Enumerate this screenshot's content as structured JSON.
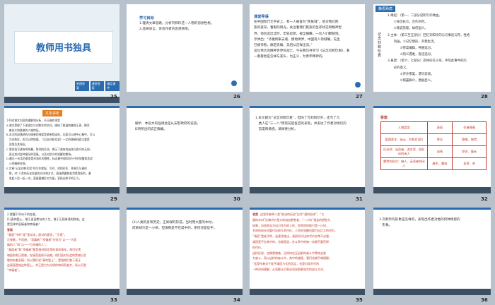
{
  "s25": {
    "title": "教师用书独具",
    "tags": [
      "补偿答案",
      "课堂答案",
      "精品课件"
    ],
    "num": "25"
  },
  "s26": {
    "hdr": "学习目标",
    "lines": [
      "1.理清文章思路，分析刘和珍这一人物的思想性格。",
      "2.品味语言，体会作者的思想感情。"
    ],
    "num": "26"
  },
  "s27": {
    "hdr": "课堂导语",
    "lines": [
      "在中国现代文学史上，有一人被誉为“民族魂”。他对我们民",
      "族的爱深，着眼的目光，关注着我们民族的生存状态和精神世",
      "界。他创造出北时，年轻思想，被全播撒，一位人们都铭刻，",
      "示弹出：“浓着倒来去看，摸地哄界，中国有人领城曦，先生",
      "已被作者，痛定思痛，又绍从这样出流。”",
      "这位伟大的精神世界的战士，今天我们共学习《记念刘和珍君》，看",
      "一看看他是怎样与某头、为正义，为青年精神的。"
    ],
    "num": "27"
  },
  "s28": {
    "hdr": "静思熟虑",
    "side": "记念刘和珍君",
    "lines": [
      "1.缘起：（第一、二部分说明写作缘由。",
      "　　①悼念执写，合作的时。",
      "　　②喻说凯理，如何国人。",
      "2.主体：（第三至五部分）回忆刘和珍的与号事迹与死，性格",
      "　　刻画。①记忆情形，刘我生活。",
      "　　　　②惨案编辑，神遍选讨。",
      "　　　　③刻义遇难，客迹选讨。",
      "3.悬望：（第六、七部分）悲悼的已义形，评简此事件的历",
      "　　史的意义。",
      "　　　　①评论惨案，遗尽悲悯。",
      "　　　　②揭露群众，激励后人。"
    ],
    "num": "28"
  },
  "s29": {
    "hdr": "文本讲析",
    "lines": [
      "下列对课文内容的理解和分析，不正确的项是",
      "A.课文是按了下述追忆与刘和珍的交往，描绘了她温和善良正直、微笑",
      "　着抗大和勇敢的人格特征。",
      "B.本文的段落结构与情感的线索是紧密相连的，后面可以使中心集中，可以",
      "　为刘和珍，也可以惨恤案。《记念刘和珍君》一文的情感线索主要是",
      "　悲愤及其悼念。",
      "C.第四段写政府的残暴，陈列的反讽，揭示了政府的凶残与群众的无知，",
      "　表达其对此种情况的悲痛，以及对民众的觉醒的期待。",
      "D.最后一句话的意思是刘和珍的牺牲，标志着中国知识分子的觉醒和其战",
      "　斗的精神发扬。",
      "E.文章“记念刘和珍君”的写作缘起、写刘、刘和珍死、并借写与事的",
      "　愤，对“人类的历史发展的方向和方式，直接揭露和批判是我所的，激",
      "　发起人民一起一次，直接震撼反对力量，宣扬出和平的正义。"
    ],
    "num": "29"
  },
  "s30": {
    "hdr": "",
    "lines": [
      "解析　本段文的强调此是从安慰政府的说道，",
      "D项所出的说正确确。"
    ],
    "num": "30"
  },
  "s31": {
    "hdr": "",
    "lines": [
      "1.本文题为“记念刘和珍君”，但除了写刘和珍外，还写了几",
      "　类人在“三一八”惨案前后各自的表现，并表达了作者对他们的",
      "　态度和情感。请阅要分析。"
    ],
    "num": "31"
  },
  "s32": {
    "hdr": "答案",
    "table": [
      [
        "人物类型",
        "表现",
        "作者情感"
      ],
      [
        "爱国青年：徒士、刘和珍(君)",
        "悍志",
        "尊敬、惋惜"
      ],
      [
        "反动派：当局者、流言家、刚反动的闲人",
        "凶残",
        "控诉、痛斥"
      ],
      [
        "庸常的民众：麻人、无恶者的闲人",
        "麻木、庸俗",
        "哀怒、奈"
      ]
    ],
    "num": "32"
  },
  "s33": {
    "lines": [
      "2.提醒下列句子的含意。",
      "(1)真的猛士，敢于直面惨淡的人生，敢于正视淋漓的鲜血。这",
      "是怎样的哀痛者和幸福者？"
    ],
    "ans": "答案",
    "alines": [
      "“真面”中的“面”是动词，面对的意思，“正视”，",
      "正视着，不回避，“哀痛者”“幸福者”分别为“以一一为哀",
      "痛的人”和“以一一为幸福的人”。",
      "“真面者”和“幸福者”都是指刘和珍等的革命青年，他们在黑",
      "暗面前和正视着，在痛悲面前不退缩。他们面对社会的黑暗以及",
      "敢的有着哀痛；所以我们说“真的猛士”，是指他们敢于真正",
      "这真面是她这种更上，并正是为为光明的和如而奋力，所以又是",
      "“幸福者”。"
    ],
    "num": "33"
  },
  "s34": {
    "lines": [
      "(2)人类的身和历史，正如煤的形成，当时用大量的木材，",
      "结果却只是一小块，但请愿是不在其中的，更何况是徒手。"
    ],
    "num": "34"
  },
  "s35": {
    "ans": "答案",
    "lines": [
      "这里作者将人类“前进的历史”比作“煤的形成”，“大",
      "量的木材”比喻代价是大的流血牺牲者，“一小块”指这的牺牲与",
      "结果，自觉地去为自己作为的人民，而死的时候只是一小块，",
      "木材的成长也要付出很大的代价，人民的觉醒也要付出巨大的代价。",
      "“请愿”是徒手的，这意思指出，请愿所付出的代价非常不必要，",
      "请愿是不在其中的，也就是说，在斗争中的每一次都不要死掉",
      "的代价。",
      "这样形说，也像是喻着，当如何在压迫前的奋斗中等地去努",
      "力奋斗，而以这样的奋斗中，其中的道理，我们也就不难理解。",
      "”这是作者对于徒手请愿方式的否定，也是对此时代的",
      "一种深刻理解，从而能认识到必须采取更坚实的战斗方式。"
    ],
    "num": "35"
  },
  "s36": {
    "lines": [
      "3.刘和珍的形象是怎样的，表现出作者对她的何种情感的",
      "　形象。"
    ],
    "num": "36"
  }
}
